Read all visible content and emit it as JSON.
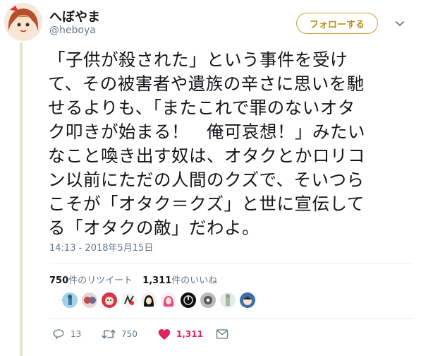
{
  "user": {
    "display_name": "へぼやま",
    "handle": "@heboya"
  },
  "follow_button_label": "フォローする",
  "tweet": {
    "lines": [
      "「子供が殺された」という事件を受け",
      "て、その被害者や遺族の辛さに思いを馳",
      "せるよりも、「またこれで罪のないオタ",
      "ク叩きが始まる！　俺可哀想！」みたい",
      "なこと喚き出す奴は、オタクとかロリコ",
      "ン以前にただの人間のクズで、そいつら",
      "こそが「オタク＝クズ」と世に宣伝して",
      "る「オタクの敵」だわよ。"
    ],
    "timestamp": "14:13 - 2018年5月15日"
  },
  "stats": {
    "retweet_count": "750",
    "retweet_label": "件のリツイート",
    "like_count": "1,311",
    "like_label": "件のいいね"
  },
  "liker_avatars": [
    "liker-avatar-1",
    "liker-avatar-2",
    "liker-avatar-3",
    "liker-avatar-4",
    "liker-avatar-5",
    "liker-avatar-6",
    "liker-avatar-7",
    "liker-avatar-8",
    "liker-avatar-9",
    "liker-avatar-10"
  ],
  "actions": {
    "reply_count": "13",
    "retweet_count": "750",
    "like_count": "1,311",
    "reply_icon": "reply-icon",
    "retweet_icon": "retweet-icon",
    "like_icon": "heart-icon",
    "dm_icon": "envelope-icon"
  },
  "colors": {
    "like": "#e0245e",
    "follow_border": "#c7a23d",
    "muted": "#657786"
  }
}
